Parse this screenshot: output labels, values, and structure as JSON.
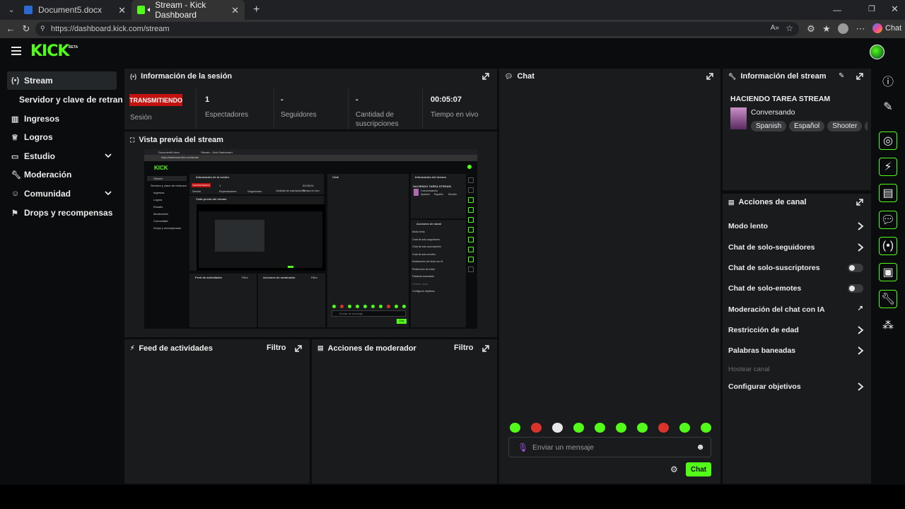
{
  "browser": {
    "tabs": [
      {
        "title": "Document5.docx"
      },
      {
        "title": "Stream - Kick Dashboard"
      }
    ],
    "url": "https://dashboard.kick.com/stream",
    "copilot_label": "Chat"
  },
  "brand": {
    "logo": "KICK",
    "beta": "BETA",
    "accent": "#53fc18"
  },
  "sidebar": {
    "items": [
      {
        "label": "Stream",
        "icon": "broadcast-icon"
      },
      {
        "label": "Servidor y clave de retransm",
        "icon": ""
      },
      {
        "label": "Ingresos",
        "icon": "bar-chart-icon"
      },
      {
        "label": "Logros",
        "icon": "trophy-icon"
      },
      {
        "label": "Estudio",
        "icon": "studio-icon"
      },
      {
        "label": "Moderación",
        "icon": "wrench-icon"
      },
      {
        "label": "Comunidad",
        "icon": "community-icon"
      },
      {
        "label": "Drops y recompensas",
        "icon": "gift-icon"
      }
    ]
  },
  "session": {
    "title": "Información de la sesión",
    "status": "TRANSMITIENDO",
    "status_label": "Sesión",
    "stats": [
      {
        "value": "1",
        "label": "Espectadores"
      },
      {
        "value": "-",
        "label": "Seguidores"
      },
      {
        "value": "-",
        "label": "Cantidad de suscripciones"
      },
      {
        "value": "00:05:07",
        "label": "Tiempo en vivo"
      }
    ]
  },
  "preview": {
    "title": "Vista previa del stream"
  },
  "feed": {
    "title": "Feed de actividades",
    "filter": "Filtro"
  },
  "mod_actions": {
    "title": "Acciones de moderador",
    "filter": "Filtro"
  },
  "chat": {
    "title": "Chat",
    "placeholder": "Enviar un mensaje",
    "send_label": "Chat"
  },
  "stream_info": {
    "title": "Información del stream",
    "stream_title": "HACIENDO TAREA STREAM",
    "category": "Conversando",
    "tags": [
      "Spanish",
      "Español",
      "Shooter"
    ]
  },
  "channel_actions": {
    "title": "Acciones de canal",
    "items": [
      {
        "label": "Modo lento",
        "control": "chevron"
      },
      {
        "label": "Chat de solo-seguidores",
        "control": "chevron"
      },
      {
        "label": "Chat de solo-suscriptores",
        "control": "toggle",
        "on": false
      },
      {
        "label": "Chat de solo-emotes",
        "control": "toggle",
        "on": false
      },
      {
        "label": "Moderación del chat con IA",
        "control": "external"
      },
      {
        "label": "Restricción de edad",
        "control": "chevron"
      },
      {
        "label": "Palabras baneadas",
        "control": "chevron"
      },
      {
        "label": "Hostear canal",
        "control": "none",
        "disabled": true
      },
      {
        "label": "Configurar objetivos",
        "control": "chevron"
      }
    ]
  },
  "mini": {
    "doc_tab": "Document5.docx",
    "stream_tab": "Stream - Kick Dashboard",
    "url": "https://dashboard.kick.com/stream",
    "logo": "KICK",
    "session_title": "Información de la sesión",
    "status": "TRANSMITIENDO",
    "status_label": "Sesión",
    "viewers": "1",
    "viewers_label": "Espectadores",
    "followers_label": "Seguidores",
    "subs_label": "Cantidad de suscripciones",
    "live_time": "00:05:04",
    "live_time_label": "Tiempo en vivo",
    "preview_title": "Vista previa del stream",
    "chat_title": "Chat",
    "info_title": "Información del stream",
    "stream_title": "HACIENDO TAREA STREAM",
    "category": "Conversando",
    "tags": [
      "Spanish",
      "Español",
      "Shooter"
    ],
    "actions_title": "Acciones de canal",
    "actions": [
      "Modo lento",
      "Chat de solo-seguidores",
      "Chat de solo-suscriptores",
      "Chat de solo-emotes",
      "Moderación del chat con IA",
      "Restricción de edad",
      "Palabras baneadas",
      "Hostear canal",
      "Configurar objetivos"
    ],
    "feed_title": "Feed de actividades",
    "mod_title": "Acciones de moderador",
    "filter": "Filtro",
    "placeholder": "Enviar un mensaje",
    "send_label": "Chat",
    "sidebar": [
      "Stream",
      "Servidor y clave de retransm",
      "Ingresos",
      "Logros",
      "Estudio",
      "Moderación",
      "Comunidad",
      "Drops y recompensas"
    ]
  }
}
